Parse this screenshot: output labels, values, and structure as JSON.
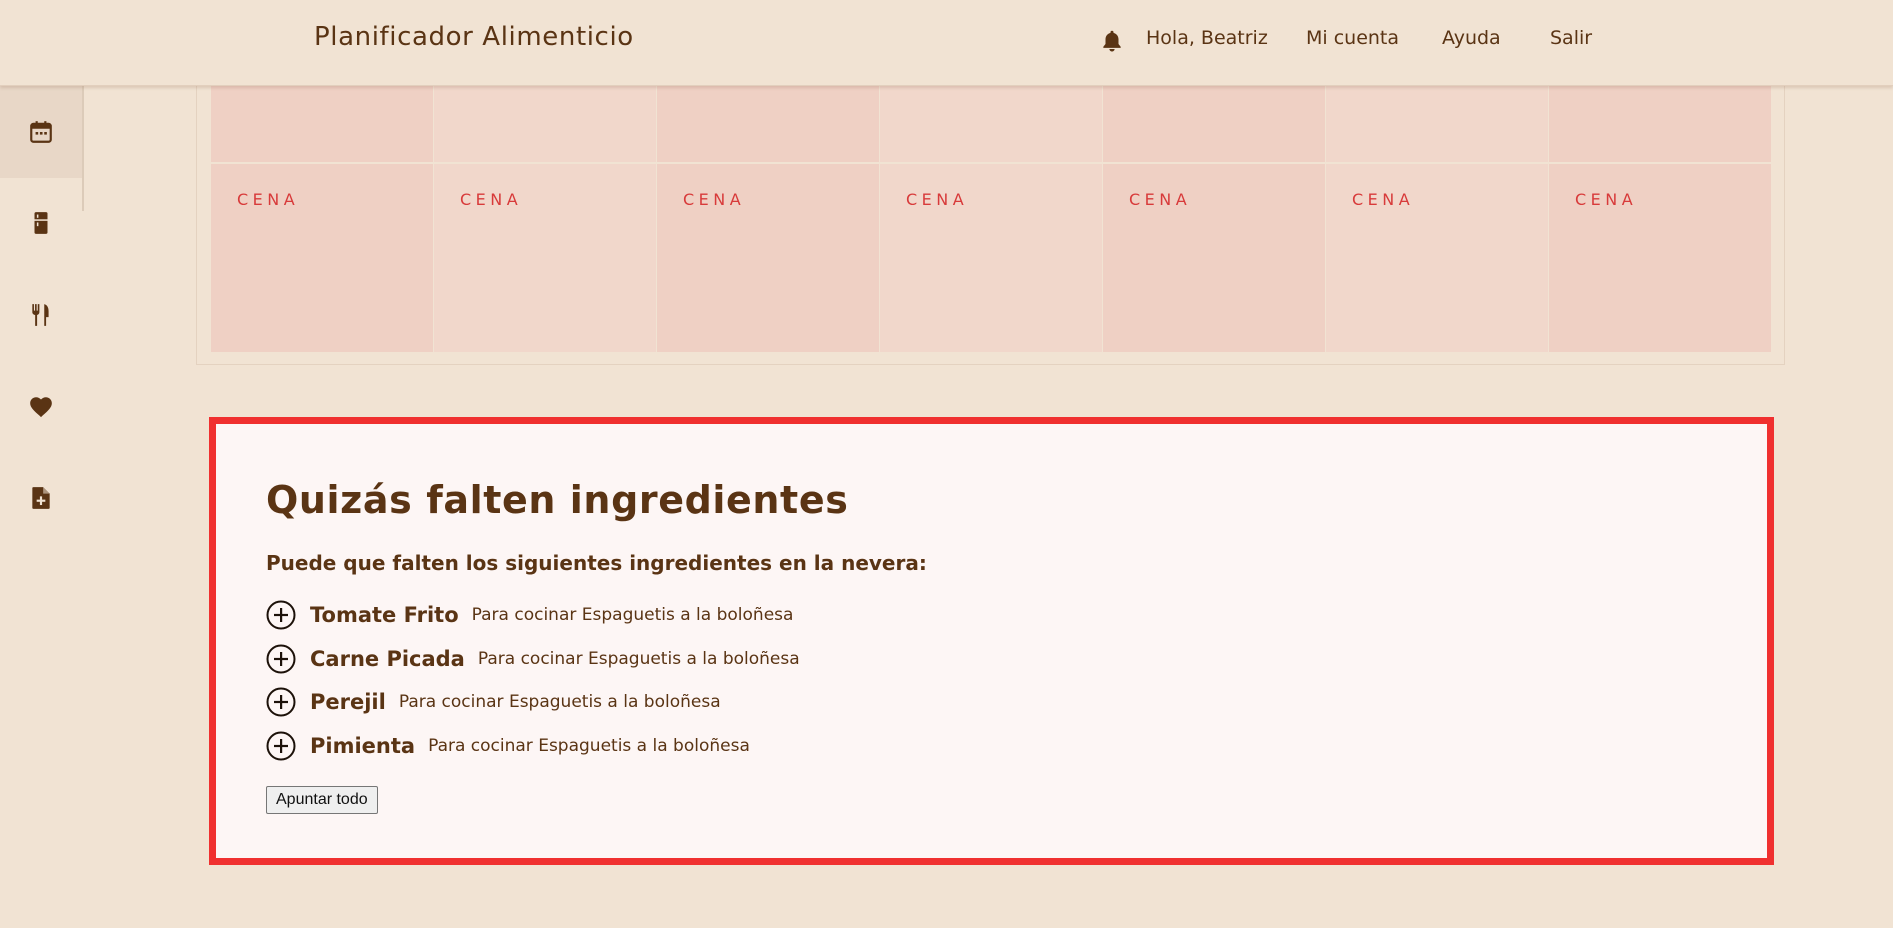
{
  "header": {
    "app_title": "Planificador Alimenticio",
    "notifications_icon": "bell-icon",
    "greeting": "Hola, Beatriz",
    "account_label": "Mi cuenta",
    "help_label": "Ayuda",
    "logout_label": "Salir"
  },
  "sidebar": {
    "items": [
      {
        "icon": "calendar-icon",
        "active": true
      },
      {
        "icon": "fridge-icon",
        "active": false
      },
      {
        "icon": "fork-knife-icon",
        "active": false
      },
      {
        "icon": "heart-icon",
        "active": false
      },
      {
        "icon": "file-add-icon",
        "active": false
      }
    ]
  },
  "calendar": {
    "dinner_label": "CENA",
    "days": 7,
    "cell_colors": [
      "#efd0c4",
      "#f1d7cb",
      "#efd0c4",
      "#f1d7cb",
      "#efd0c4",
      "#f1d7cb",
      "#efd0c4"
    ]
  },
  "missing": {
    "title": "Quizás falten ingredientes",
    "subtitle": "Puede que falten los siguientes ingredientes en la nevera:",
    "items": [
      {
        "name": "Tomate Frito",
        "desc": "Para cocinar Espaguetis a la boloñesa"
      },
      {
        "name": "Carne Picada",
        "desc": "Para cocinar Espaguetis a la boloñesa"
      },
      {
        "name": "Perejil",
        "desc": "Para cocinar Espaguetis a la boloñesa"
      },
      {
        "name": "Pimienta",
        "desc": "Para cocinar Espaguetis a la boloñesa"
      }
    ],
    "note_all_label": "Apuntar todo"
  },
  "colors": {
    "background": "#f1e3d3",
    "text": "#5a3414",
    "accent_red": "#f0302f",
    "meal_label": "#d83a3a",
    "panel_bg": "#fdf6f5"
  }
}
